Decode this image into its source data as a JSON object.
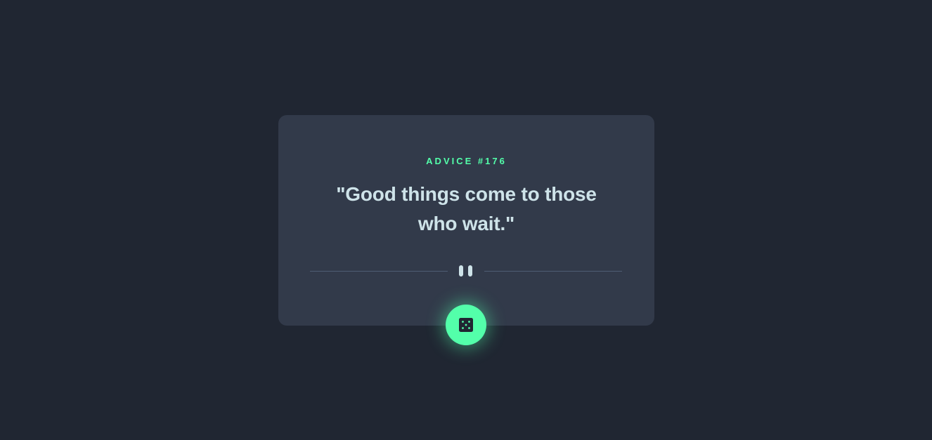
{
  "card": {
    "advice_label": "ADVICE #176",
    "quote": "\"Good things come to those who wait.\""
  },
  "divider": {
    "icon": "pause-icon"
  },
  "dice_button": {
    "icon": "dice-icon",
    "accent": "#53ffaa"
  },
  "colors": {
    "background": "#202632",
    "card": "#323a4a",
    "accent": "#53ffaa",
    "text": "#cee3e9",
    "divider": "#4f5d74"
  }
}
